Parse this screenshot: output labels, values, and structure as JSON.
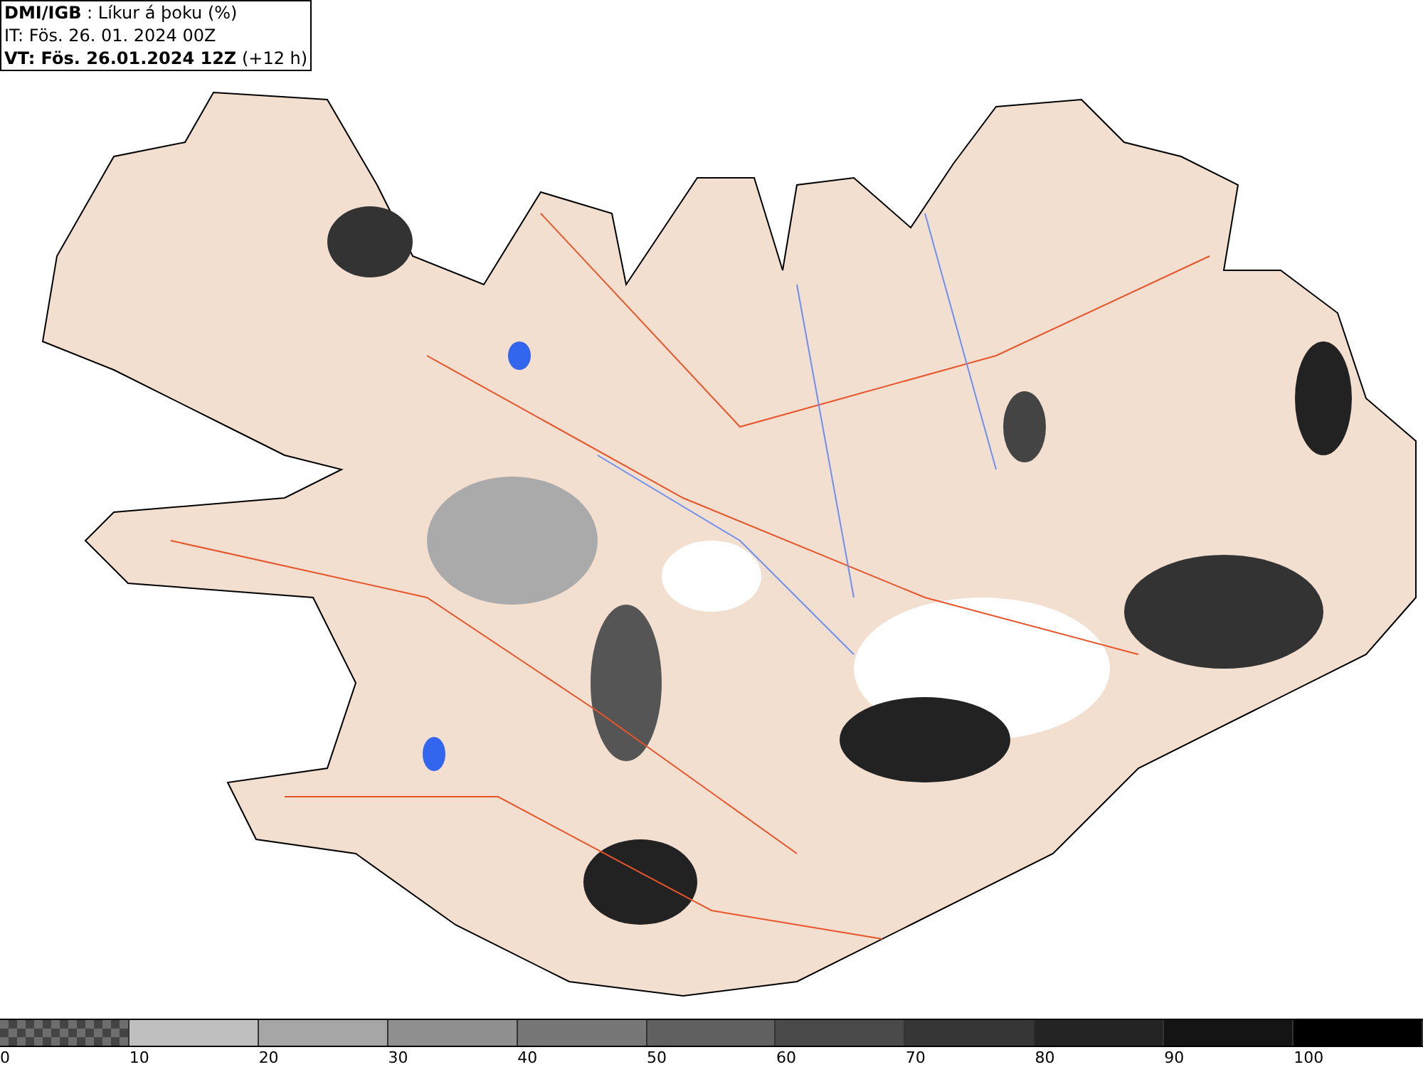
{
  "header": {
    "source": "DMI/IGB",
    "title": " : Líkur á þoku (%)",
    "initial_time": "IT: Fös. 26. 01. 2024 00Z",
    "valid_label": "VT: Fös. 26.01.2024 12Z",
    "valid_offset": "(+12 h)"
  },
  "legend": [
    {
      "label": "0",
      "kind": "pattern",
      "color": "#6e6e6e"
    },
    {
      "label": "10",
      "kind": "solid",
      "color": "#bfbfbf"
    },
    {
      "label": "20",
      "kind": "solid",
      "color": "#a6a6a6"
    },
    {
      "label": "30",
      "kind": "solid",
      "color": "#8f8f8f"
    },
    {
      "label": "40",
      "kind": "solid",
      "color": "#777777"
    },
    {
      "label": "50",
      "kind": "solid",
      "color": "#606060"
    },
    {
      "label": "60",
      "kind": "solid",
      "color": "#4a4a4a"
    },
    {
      "label": "70",
      "kind": "solid",
      "color": "#363636"
    },
    {
      "label": "80",
      "kind": "solid",
      "color": "#242424"
    },
    {
      "label": "90",
      "kind": "solid",
      "color": "#141414"
    },
    {
      "label": "100",
      "kind": "solid",
      "color": "#000000"
    }
  ]
}
